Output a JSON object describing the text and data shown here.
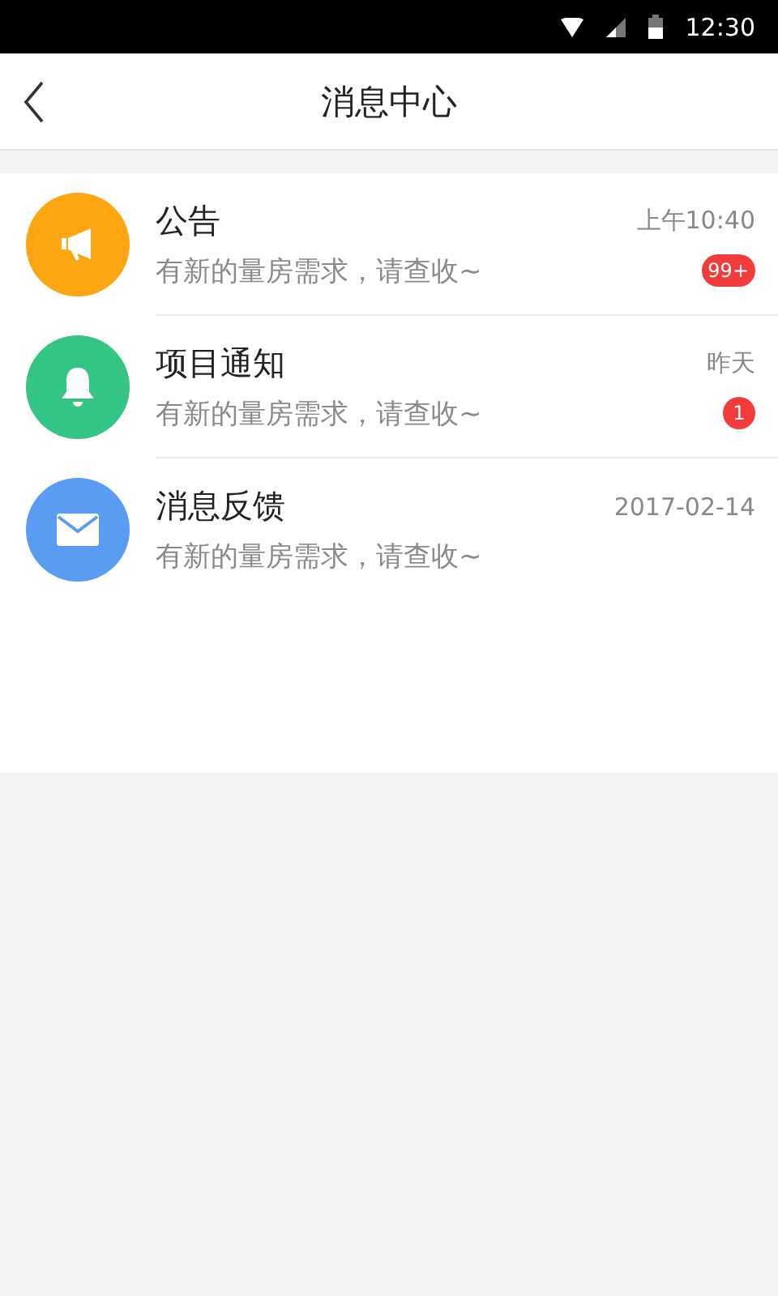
{
  "status_bar": {
    "time": "12:30"
  },
  "header": {
    "title": "消息中心"
  },
  "messages": [
    {
      "kind": "megaphone",
      "color": "#fea611",
      "title": "公告",
      "preview": "有新的量房需求，请查收~",
      "time": "上午10:40",
      "badge": "99+"
    },
    {
      "kind": "bell",
      "color": "#34c483",
      "title": "项目通知",
      "preview": "有新的量房需求，请查收~",
      "time": "昨天",
      "badge": "1"
    },
    {
      "kind": "mail",
      "color": "#5a9cf1",
      "title": "消息反馈",
      "preview": "有新的量房需求，请查收~",
      "time": "2017-02-14"
    }
  ]
}
